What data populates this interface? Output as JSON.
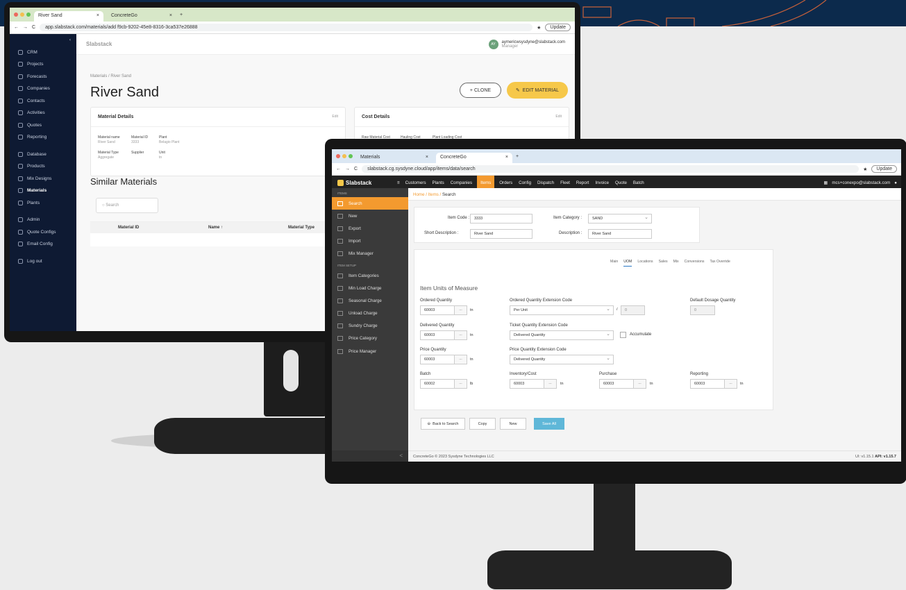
{
  "colors": {
    "navy": "#0c2a4c",
    "accent_yellow": "#f6c84a",
    "accent_orange": "#f39a2f",
    "save_blue": "#5fb7d8"
  },
  "monitor1": {
    "tabs": [
      "River Sand",
      "ConcreteGo"
    ],
    "url": "app.slabstack.com/materials/add f9cb-9202-45e8-8316-3ca537e26888",
    "update_label": "Update",
    "sidebar": [
      {
        "label": "CRM",
        "icon": "crm-icon"
      },
      {
        "label": "Projects",
        "icon": "projects-icon"
      },
      {
        "label": "Forecasts",
        "icon": "forecasts-icon"
      },
      {
        "label": "Companies",
        "icon": "companies-icon"
      },
      {
        "label": "Contacts",
        "icon": "contacts-icon"
      },
      {
        "label": "Activities",
        "icon": "activities-icon"
      },
      {
        "label": "Quotes",
        "icon": "quotes-icon"
      },
      {
        "label": "Reporting",
        "icon": "reporting-icon"
      },
      {
        "label": "Database",
        "icon": "database-icon"
      },
      {
        "label": "Products",
        "icon": "products-icon"
      },
      {
        "label": "Mix Designs",
        "icon": "mix-designs-icon"
      },
      {
        "label": "Materials",
        "icon": "materials-icon"
      },
      {
        "label": "Plants",
        "icon": "plants-icon"
      },
      {
        "label": "Admin",
        "icon": "admin-icon"
      },
      {
        "label": "Quote Configs",
        "icon": "quote-configs-icon"
      },
      {
        "label": "Email Config",
        "icon": "email-config-icon"
      },
      {
        "label": "Log out",
        "icon": "logout-icon"
      }
    ],
    "logo": "Slabstack",
    "user_email": "aymericwsysdyne@slabstack.com",
    "user_role": "Manager",
    "user_initials": "AY",
    "breadcrumb": "Materials / River Sand",
    "title": "River Sand",
    "clone_label": "+ CLONE",
    "edit_label": "EDIT MATERIAL",
    "material_details_title": "Material Details",
    "cost_details_title": "Cost Details",
    "edit_link": "Edit",
    "material_fields": [
      {
        "k": "Material name",
        "v": "River Sand"
      },
      {
        "k": "Material ID",
        "v": "3333"
      },
      {
        "k": "Plant",
        "v": "Belagio Plant"
      },
      {
        "k": "Material Type",
        "v": "Aggregate"
      },
      {
        "k": "Supplier",
        "v": ""
      },
      {
        "k": "Unit",
        "v": "tn"
      }
    ],
    "cost_fields": [
      "Raw Material Cost",
      "Hauling Cost",
      "Plant Loading Cost"
    ],
    "similar_title": "Similar Materials",
    "search_placeholder": "Search",
    "table_headers": [
      "Material ID",
      "Name ↑",
      "Material Type"
    ]
  },
  "monitor2": {
    "tabs": [
      "Materials",
      "ConcreteGo"
    ],
    "url": "slabstack.cg.sysdyne.cloud/app/items/data/search",
    "update_label": "Update",
    "logo": "Slabstack",
    "menu": [
      "Customers",
      "Plants",
      "Companies",
      "Items",
      "Orders",
      "Config",
      "Dispatch",
      "Fleet",
      "Report",
      "Invoice",
      "Quote",
      "Batch"
    ],
    "active_menu": "Items",
    "user": "mcs+conexpo@slabstack.com",
    "side_section1": "ITEMS",
    "side_items1": [
      "Search",
      "New",
      "Export",
      "Import",
      "Mix Manager"
    ],
    "side_section2": "ITEM SETUP",
    "side_items2": [
      "Item Categories",
      "Min Load Charge",
      "Seasonal Charge",
      "Unload Charge",
      "Sundry Charge",
      "Price Category",
      "Price Manager"
    ],
    "breadcrumb": {
      "home": "Home",
      "items": "Items",
      "current": "Search"
    },
    "item_code_label": "Item Code :",
    "item_code": "3333",
    "item_category_label": "Item Category :",
    "item_category": "SAND",
    "short_desc_label": "Short Description :",
    "short_desc": "River Sand",
    "desc_label": "Description :",
    "desc": "River Sand",
    "tabs_detail": [
      "Main",
      "UOM",
      "Locations",
      "Sales",
      "Mix",
      "Conversions",
      "Tax Override"
    ],
    "active_detail_tab": "UOM",
    "uom_title": "Item Units of Measure",
    "ordered_qty_label": "Ordered Quantity",
    "ordered_qty": "60003",
    "ordered_ext_label": "Ordered Quantity Extension Code",
    "ordered_ext": "Per Unit",
    "ordered_ext_num": "0",
    "default_dosage_label": "Default Dosage Quantity",
    "default_dosage": "0",
    "delivered_qty_label": "Delivered Quantity",
    "delivered_qty": "60003",
    "ticket_ext_label": "Ticket Quantity Extension Code",
    "ticket_ext": "Delivered Quantity",
    "accumulate_label": "Accumulate",
    "price_qty_label": "Price Quantity",
    "price_qty": "60003",
    "price_ext_label": "Price Quantity Extension Code",
    "price_ext": "Delivered Quantity",
    "batch_label": "Batch",
    "batch": "60002",
    "inventory_label": "Inventory/Cost",
    "inventory": "60003",
    "purchase_label": "Purchase",
    "purchase": "60003",
    "reporting_label": "Reporting",
    "reporting": "60003",
    "unit_tn": "tn",
    "unit_lb": "lb",
    "dots": "...",
    "slash": "/",
    "back_label": "Back to Search",
    "copy_label": "Copy",
    "new_label": "New",
    "save_label": "Save All",
    "footer_left": "ConcreteGo © 2023 Sysdyne Technologies LLC",
    "footer_ui": "UI: v1.15.1",
    "footer_api": "API: v1.15.7",
    "collapse_glyph": "<"
  }
}
